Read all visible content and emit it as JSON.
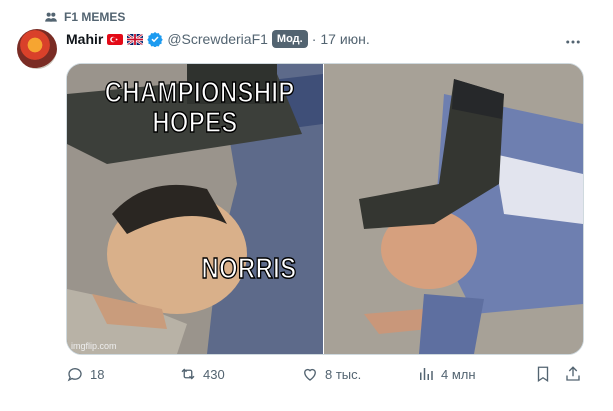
{
  "community": {
    "icon": "people-icon",
    "label": "F1 MEMES"
  },
  "post": {
    "author_name": "Mahir",
    "flags": [
      "turkey-flag",
      "uk-flag"
    ],
    "verified_icon": "verified-badge-icon",
    "handle": "@ScrewderiaF1",
    "role_badge": "Мод.",
    "separator": "·",
    "date": "17 июн.",
    "more_icon": "more-icon"
  },
  "meme": {
    "top_text": "CHAMPIONSHIP\nHOPES",
    "bottom_text": "NORRIS",
    "watermark": "imgflip.com"
  },
  "actions": {
    "replies": "18",
    "reposts": "430",
    "likes": "8 тыс.",
    "views": "4 млн"
  },
  "colors": {
    "verified": "#1d9bf0",
    "secondary_text": "#536471",
    "badge_bg": "#536471"
  }
}
